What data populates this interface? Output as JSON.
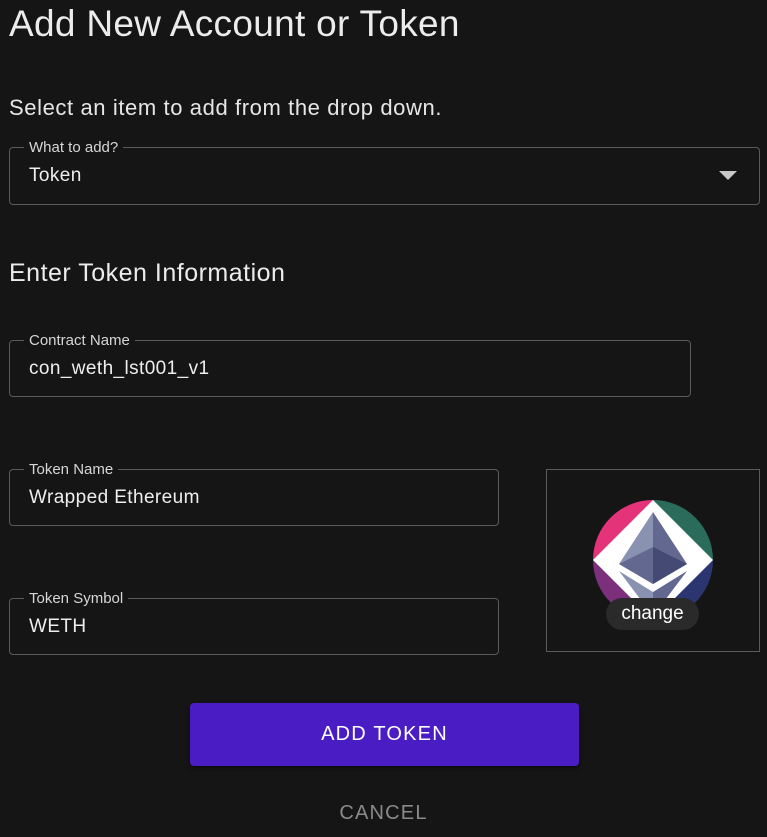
{
  "page": {
    "title": "Add New Account or Token",
    "instruction": "Select an item to add from the drop down."
  },
  "type_select": {
    "label": "What to add?",
    "value": "Token"
  },
  "section": {
    "title": "Enter Token Information"
  },
  "contract_name": {
    "label": "Contract Name",
    "value": "con_weth_lst001_v1"
  },
  "token_name": {
    "label": "Token Name",
    "value": "Wrapped Ethereum"
  },
  "token_symbol": {
    "label": "Token Symbol",
    "value": "WETH"
  },
  "token_image": {
    "icon": "ethereum-logo-icon",
    "change_label": "change"
  },
  "actions": {
    "add_label": "ADD TOKEN",
    "cancel_label": "CANCEL"
  },
  "colors": {
    "background": "#151515",
    "primary_button": "#4a1cc4",
    "logo_pink": "#e5337a",
    "logo_teal": "#2a6b5c",
    "logo_navy": "#2b3670",
    "logo_purple": "#7c2f7a"
  }
}
